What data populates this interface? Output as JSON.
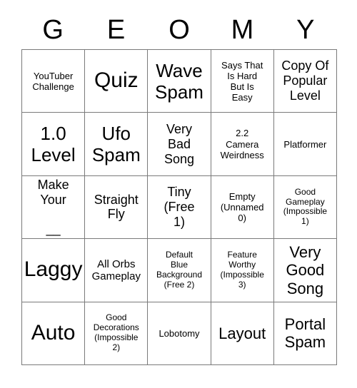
{
  "card": {
    "title_letters": [
      "G",
      "E",
      "O",
      "M",
      "Y"
    ],
    "colors": {
      "background": "#ffffff",
      "grid_line": "#7a7a7a",
      "text": "#000000"
    },
    "rows": [
      [
        {
          "text": "YouTuber\nChallenge",
          "size": "xs"
        },
        {
          "text": "Quiz",
          "size": "xxl"
        },
        {
          "text": "Wave\nSpam",
          "size": "xl"
        },
        {
          "text": "Says That\nIs Hard\nBut Is\nEasy",
          "size": "xs"
        },
        {
          "text": "Copy Of\nPopular\nLevel",
          "size": "m"
        }
      ],
      [
        {
          "text": "1.0\nLevel",
          "size": "xl"
        },
        {
          "text": "Ufo\nSpam",
          "size": "xl"
        },
        {
          "text": "Very\nBad\nSong",
          "size": "m"
        },
        {
          "text": "2.2\nCamera\nWeirdness",
          "size": "xs"
        },
        {
          "text": "Platformer",
          "size": "xs"
        }
      ],
      [
        {
          "text": "Make\nYour\n\n__",
          "size": "m"
        },
        {
          "text": "Straight\nFly",
          "size": "m"
        },
        {
          "text": "Tiny\n(Free\n1)",
          "size": "m"
        },
        {
          "text": "Empty\n(Unnamed\n0)",
          "size": "xs"
        },
        {
          "text": "Good\nGameplay\n(Impossible\n1)",
          "size": "xxs"
        }
      ],
      [
        {
          "text": "Laggy",
          "size": "xxl"
        },
        {
          "text": "All Orbs\nGameplay",
          "size": "s"
        },
        {
          "text": "Default\nBlue\nBackground\n(Free 2)",
          "size": "xxs"
        },
        {
          "text": "Feature\nWorthy\n(Impossible\n3)",
          "size": "xxs"
        },
        {
          "text": "Very\nGood\nSong",
          "size": "l"
        }
      ],
      [
        {
          "text": "Auto",
          "size": "xxl"
        },
        {
          "text": "Good\nDecorations\n(Impossible\n2)",
          "size": "xxs"
        },
        {
          "text": "Lobotomy",
          "size": "xs"
        },
        {
          "text": "Layout",
          "size": "l"
        },
        {
          "text": "Portal\nSpam",
          "size": "l"
        }
      ]
    ]
  }
}
